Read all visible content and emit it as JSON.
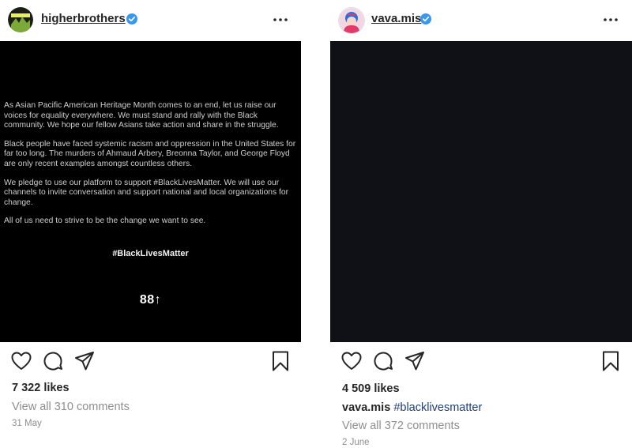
{
  "posts": [
    {
      "username": "higherbrothers",
      "statement": [
        "As Asian Pacific American Heritage Month comes to an end, let us raise our voices for equality everywhere. We must stand and rally with the Black community. We hope our fellow Asians take action and share in the struggle.",
        "Black people have faced systemic racism and oppression in the United States for far too long. The murders of Ahmaud Arbery, Breonna Taylor, and George Floyd are only recent examples amongst countless others.",
        "We pledge to use our platform to support #BlackLivesMatter. We will use our channels to invite conversation and support national and local organizations for change.",
        "All of us need to strive to be the change we want to see."
      ],
      "image_hashtag": "#BlackLivesMatter",
      "image_logo": "88↑",
      "likes": "7 322 likes",
      "comments": "View all 310 comments",
      "date": "31 May"
    },
    {
      "username": "vava.mis",
      "likes": "4 509 likes",
      "caption_user": "vava.mis",
      "caption_tag": "#blacklivesmatter",
      "comments": "View all 372 comments",
      "date": "2 June"
    }
  ],
  "icons": {
    "like": "heart-outline-icon",
    "comment": "comment-bubble-icon",
    "share": "paper-plane-icon",
    "save": "bookmark-icon",
    "more": "more-options-icon",
    "verified": "verified-badge-icon"
  },
  "colors": {
    "verified_badge": "#3897f0",
    "secondary_text": "#8e8e8e",
    "hashtag_link": "#1f3f7a",
    "right_image_background": "#0f1116"
  }
}
